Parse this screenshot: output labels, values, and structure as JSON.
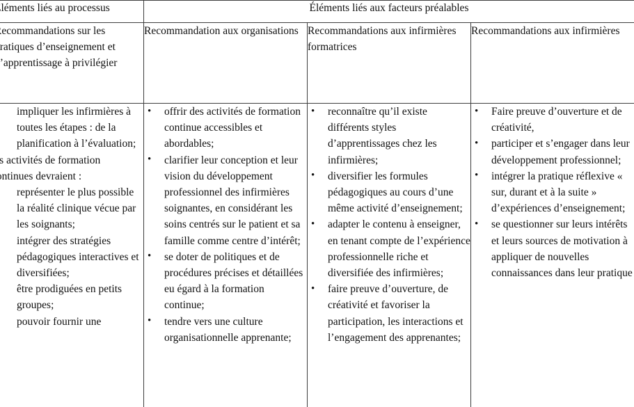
{
  "table": {
    "group_headers": [
      {
        "label": "Éléments liés au processus",
        "colspan": 1,
        "align": "left"
      },
      {
        "label": "Éléments liés aux facteurs préalables",
        "colspan": 3,
        "align": "center"
      }
    ],
    "column_headers": [
      "Recommandations sur les pratiques d’enseignement et d’apprentissage à privilégier",
      "Recommandation aux organisations",
      "Recommandations aux infirmières formatrices",
      "Recommandations aux infirmières"
    ],
    "columns": [
      {
        "name": "pratiques-enseignement",
        "blocks": [
          {
            "type": "list",
            "items": [
              "impliquer les infirmières à toutes les étapes : de la planification à l’évaluation;"
            ]
          },
          {
            "type": "paragraph",
            "text": "les activités de formation continues devraient :"
          },
          {
            "type": "list",
            "items": [
              "représenter le plus possible la réalité clinique vécue par les soignants;",
              "intégrer des stratégies pédagogiques interactives et diversifiées;",
              "être prodiguées en petits groupes;",
              "pouvoir fournir une"
            ]
          }
        ]
      },
      {
        "name": "organisations",
        "blocks": [
          {
            "type": "list",
            "items": [
              "offrir des activités de formation continue accessibles et abordables;",
              "clarifier leur conception et leur vision du développement professionnel des infirmières soignantes, en considérant les soins centrés sur le patient et sa famille comme centre d’intérêt;",
              "se doter de politiques et de procédures précises et détaillées eu égard à la formation continue;",
              "tendre vers une culture organisationnelle apprenante;"
            ]
          }
        ]
      },
      {
        "name": "infirmieres-formatrices",
        "blocks": [
          {
            "type": "list",
            "items": [
              "reconnaître qu’il existe différents styles d’apprentissages chez les infirmières;",
              "diversifier les formules pédagogiques au cours d’une même activité d’enseignement;",
              "adapter le contenu à enseigner, en tenant compte de l’expérience professionnelle riche et diversifiée des infirmières;",
              "faire preuve d’ouverture, de créativité et favoriser la participation, les interactions et l’engagement des apprenantes;"
            ]
          }
        ]
      },
      {
        "name": "infirmieres",
        "blocks": [
          {
            "type": "list",
            "items": [
              "Faire preuve d’ouverture et de créativité,",
              "participer et s’engager dans leur développement professionnel;",
              "intégrer la pratique réflexive « sur, durant et à la suite » d’expériences d’enseignement;",
              "se questionner sur leurs intérêts et leurs sources de motivation à appliquer de nouvelles connaissances dans leur pratique"
            ]
          }
        ]
      }
    ]
  }
}
